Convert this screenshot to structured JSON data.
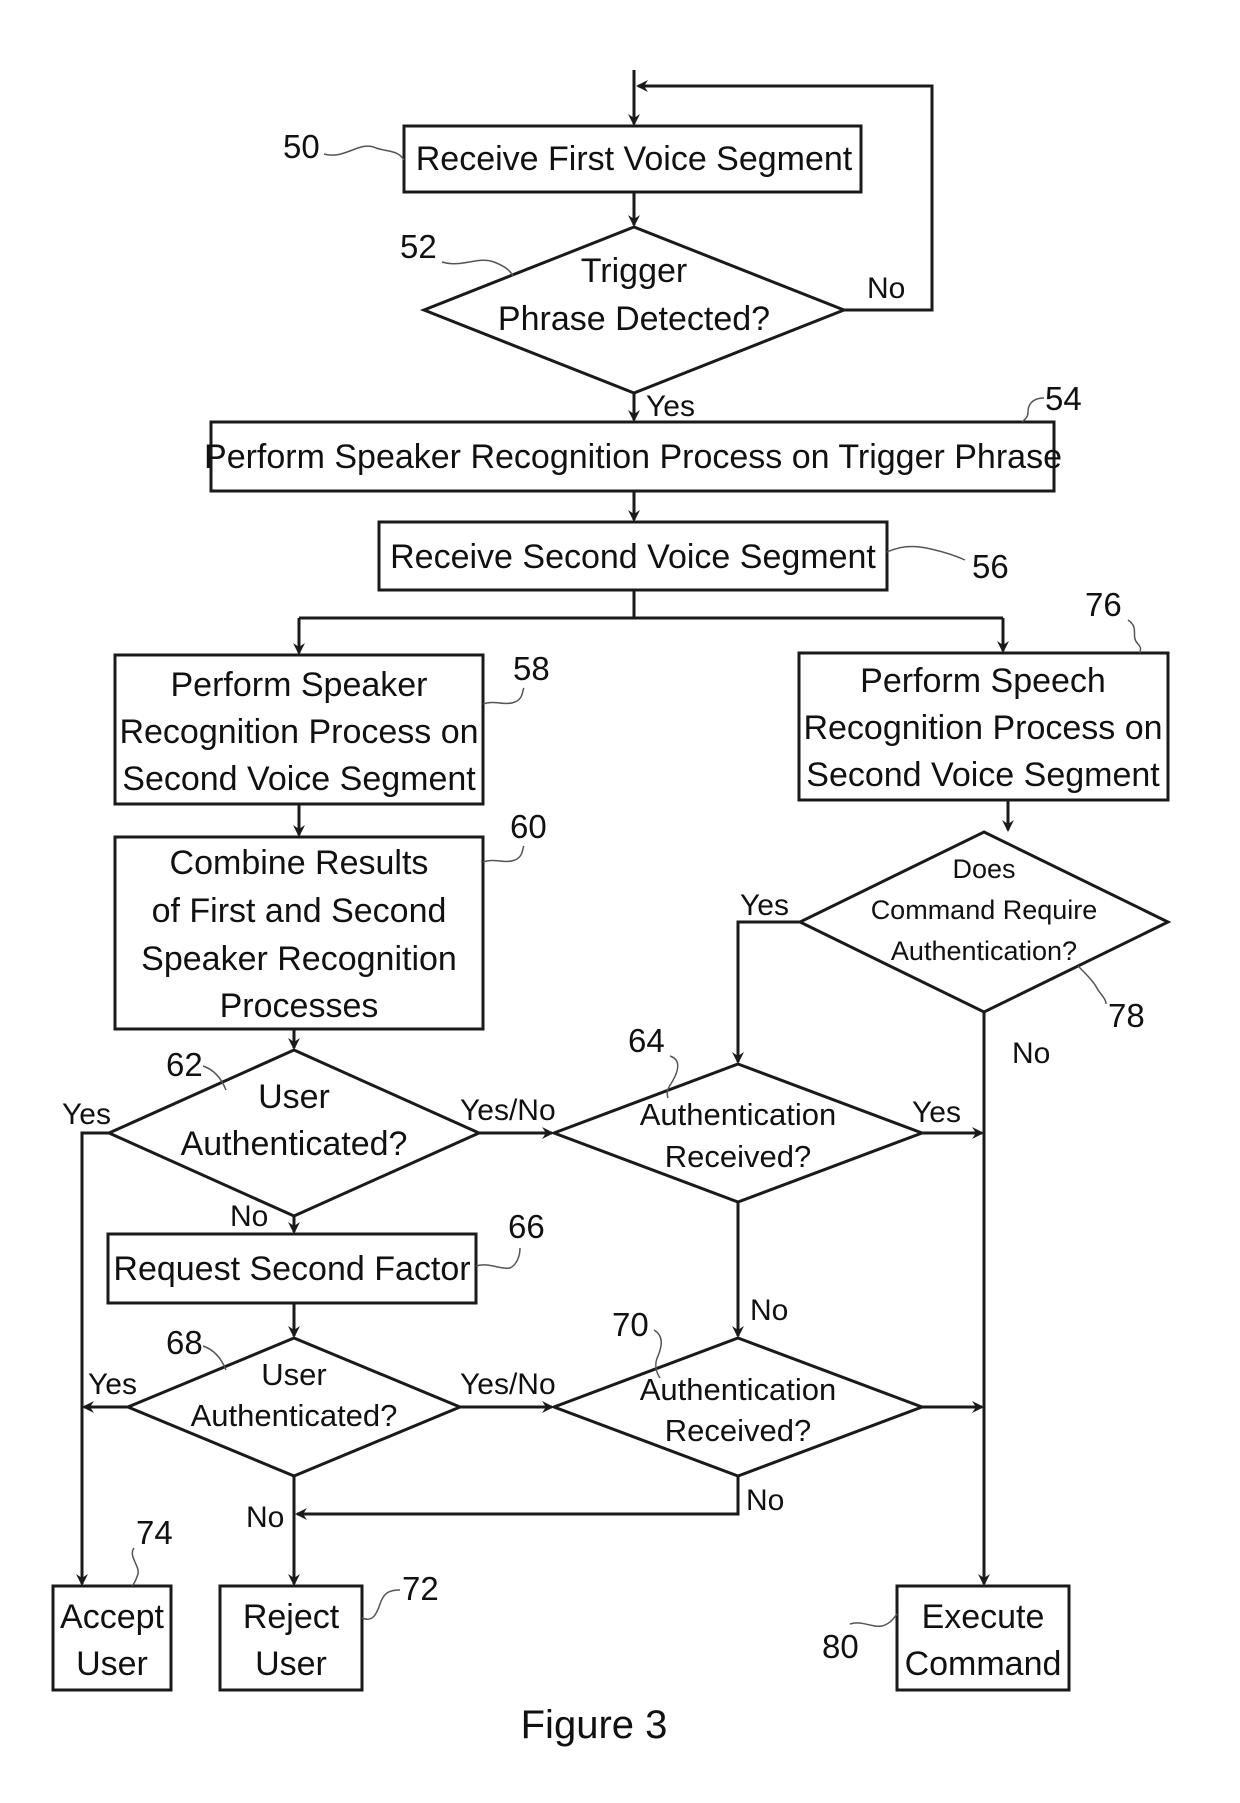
{
  "figure": {
    "caption": "Figure 3",
    "nodes": {
      "n50": {
        "ref": "50",
        "type": "process",
        "lines": [
          "Receive First Voice Segment"
        ]
      },
      "n52": {
        "ref": "52",
        "type": "decision",
        "lines": [
          "Trigger",
          "Phrase Detected?"
        ]
      },
      "n54": {
        "ref": "54",
        "type": "process",
        "lines": [
          "Perform Speaker Recognition Process on Trigger Phrase"
        ]
      },
      "n56": {
        "ref": "56",
        "type": "process",
        "lines": [
          "Receive Second Voice Segment"
        ]
      },
      "n58": {
        "ref": "58",
        "type": "process",
        "lines": [
          "Perform Speaker",
          "Recognition Process on",
          "Second Voice Segment"
        ]
      },
      "n60": {
        "ref": "60",
        "type": "process",
        "lines": [
          "Combine Results",
          "of First and Second",
          "Speaker Recognition",
          "Processes"
        ]
      },
      "n62": {
        "ref": "62",
        "type": "decision",
        "lines": [
          "User",
          "Authenticated?"
        ]
      },
      "n64": {
        "ref": "64",
        "type": "decision",
        "lines": [
          "Authentication",
          "Received?"
        ]
      },
      "n66": {
        "ref": "66",
        "type": "process",
        "lines": [
          "Request Second Factor"
        ]
      },
      "n68": {
        "ref": "68",
        "type": "decision",
        "lines": [
          "User",
          "Authenticated?"
        ]
      },
      "n70": {
        "ref": "70",
        "type": "decision",
        "lines": [
          "Authentication",
          "Received?"
        ]
      },
      "n72": {
        "ref": "72",
        "type": "terminal",
        "lines": [
          "Reject",
          "User"
        ]
      },
      "n74": {
        "ref": "74",
        "type": "terminal",
        "lines": [
          "Accept",
          "User"
        ]
      },
      "n76": {
        "ref": "76",
        "type": "process",
        "lines": [
          "Perform Speech",
          "Recognition Process on",
          "Second Voice Segment"
        ]
      },
      "n78": {
        "ref": "78",
        "type": "decision",
        "lines": [
          "Does",
          "Command Require",
          "Authentication?"
        ]
      },
      "n80": {
        "ref": "80",
        "type": "terminal",
        "lines": [
          "Execute",
          "Command"
        ]
      }
    },
    "edge_labels": {
      "n52_no": "No",
      "n52_yes": "Yes",
      "n62_yes": "Yes",
      "n62_yesno": "Yes/No",
      "n62_no": "No",
      "n64_yes": "Yes",
      "n64_no": "No",
      "n68_yes": "Yes",
      "n68_yesno": "Yes/No",
      "n68_no": "No",
      "n70_no": "No",
      "n78_yes": "Yes",
      "n78_no": "No"
    }
  }
}
